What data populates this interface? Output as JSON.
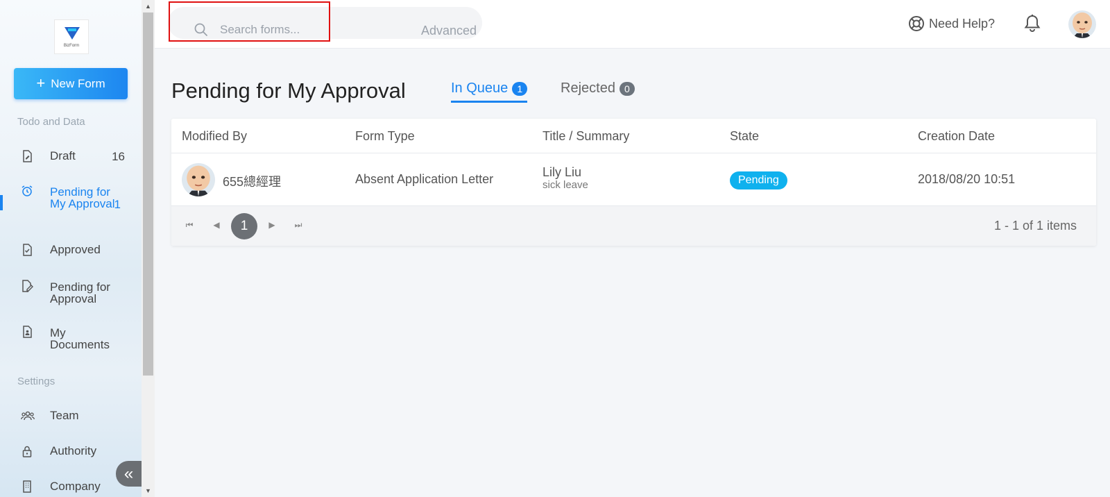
{
  "sidebar": {
    "logo_text": "BizForm",
    "new_form_label": "New Form",
    "section_todo": "Todo and Data",
    "section_settings": "Settings",
    "items": [
      {
        "label": "Draft",
        "count": "16",
        "icon": "draft-icon"
      },
      {
        "label": "Pending for My Approval",
        "count": "1",
        "icon": "alarm-clock-icon",
        "active": true
      },
      {
        "label": "Approved",
        "count": "",
        "icon": "approved-doc-icon"
      },
      {
        "label": "Pending for Approval",
        "count": "",
        "icon": "edit-doc-icon"
      },
      {
        "label": "My Documents",
        "count": "",
        "icon": "user-doc-icon"
      },
      {
        "label": "Team",
        "count": "",
        "icon": "team-icon"
      },
      {
        "label": "Authority",
        "count": "",
        "icon": "lock-icon"
      },
      {
        "label": "Company",
        "count": "",
        "icon": "building-icon"
      }
    ],
    "collapse_symbol": "«"
  },
  "topbar": {
    "search_placeholder": "Search forms...",
    "advanced_label": "Advanced",
    "help_label": "Need Help?"
  },
  "main": {
    "title": "Pending for My Approval",
    "tabs": [
      {
        "label": "In Queue",
        "count": "1",
        "active": true
      },
      {
        "label": "Rejected",
        "count": "0",
        "active": false
      }
    ],
    "table": {
      "columns": [
        "Modified By",
        "Form Type",
        "Title / Summary",
        "State",
        "Creation Date"
      ],
      "rows": [
        {
          "modified_by": "655總經理",
          "form_type": "Absent Application Letter",
          "title": "Lily Liu",
          "summary": "sick leave",
          "state": "Pending",
          "creation_date": "2018/08/20 10:51"
        }
      ]
    },
    "pager": {
      "current_page": "1",
      "info": "1 - 1 of 1 items"
    }
  },
  "colors": {
    "accent": "#1a84f0",
    "pending": "#0fb1ee",
    "highlight": "#e01010"
  }
}
